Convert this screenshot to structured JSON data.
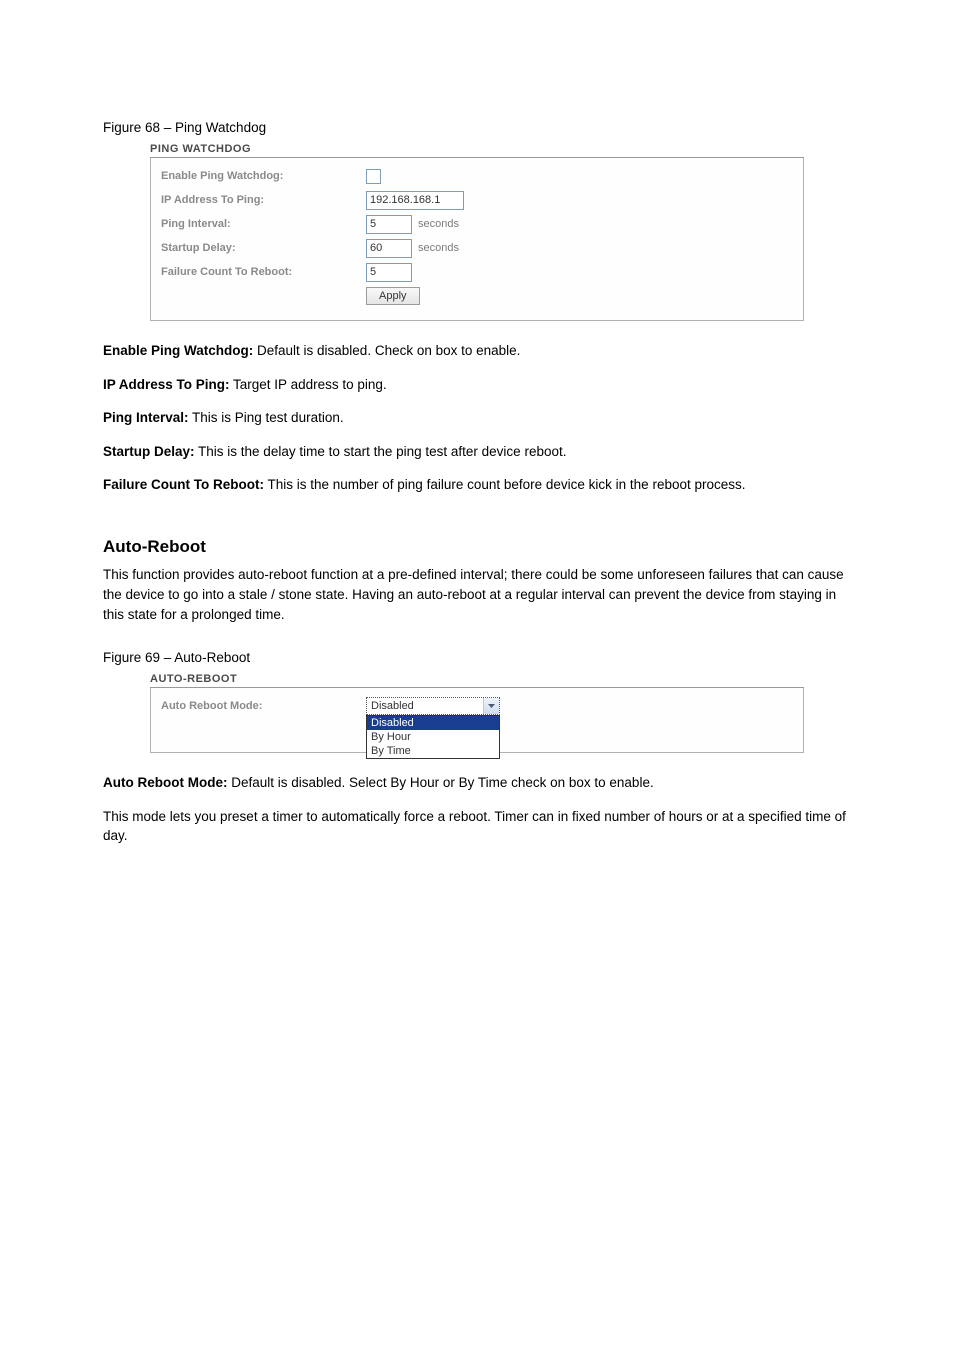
{
  "pingWatchdog": {
    "figureCaption": "Figure 68 – Ping Watchdog",
    "sectionTitle": "PING WATCHDOG",
    "labels": {
      "enable": "Enable Ping Watchdog:",
      "ip": "IP Address To Ping:",
      "interval": "Ping Interval:",
      "startup": "Startup Delay:",
      "failcount": "Failure Count To Reboot:"
    },
    "values": {
      "ip": "192.168.168.1",
      "interval": "5",
      "startup": "60",
      "failcount": "5"
    },
    "units": {
      "seconds": "seconds"
    },
    "applyLabel": "Apply",
    "descriptions": {
      "enable": {
        "label": "Enable Ping Watchdog:",
        "text": " Default is disabled. Check on box to enable."
      },
      "ip": {
        "label": "IP Address To Ping:",
        "text": " Target IP address to ping."
      },
      "interval": {
        "label": "Ping Interval:",
        "text": " This is Ping test duration."
      },
      "startup": {
        "label": "Startup Delay:",
        "text": " This is the delay time to start the ping test after device reboot."
      },
      "failcount": {
        "label": "Failure Count To Reboot:",
        "text": " This is the number of ping failure count before device kick in the reboot process."
      }
    }
  },
  "autoReboot": {
    "heading": "Auto-Reboot",
    "headingText": "This function provides auto-reboot function at a pre-defined interval; there could be some unforeseen failures that can cause the device to go into a stale / stone state. Having an auto-reboot at a regular interval can prevent the device from staying in this state for a prolonged time.",
    "figureCaption": "Figure 69 – Auto-Reboot",
    "sectionTitle": "AUTO-REBOOT",
    "label": "Auto Reboot Mode:",
    "selected": "Disabled",
    "options": [
      "Disabled",
      "By Hour",
      "By Time"
    ],
    "descriptions": {
      "mode": {
        "label": "Auto Reboot Mode:",
        "text": " Default is disabled. Select By Hour or By Time check on box to enable."
      },
      "modeNote": "This mode lets you preset a timer to automatically force a reboot. Timer can in fixed number of hours or at a specified time of day."
    }
  }
}
